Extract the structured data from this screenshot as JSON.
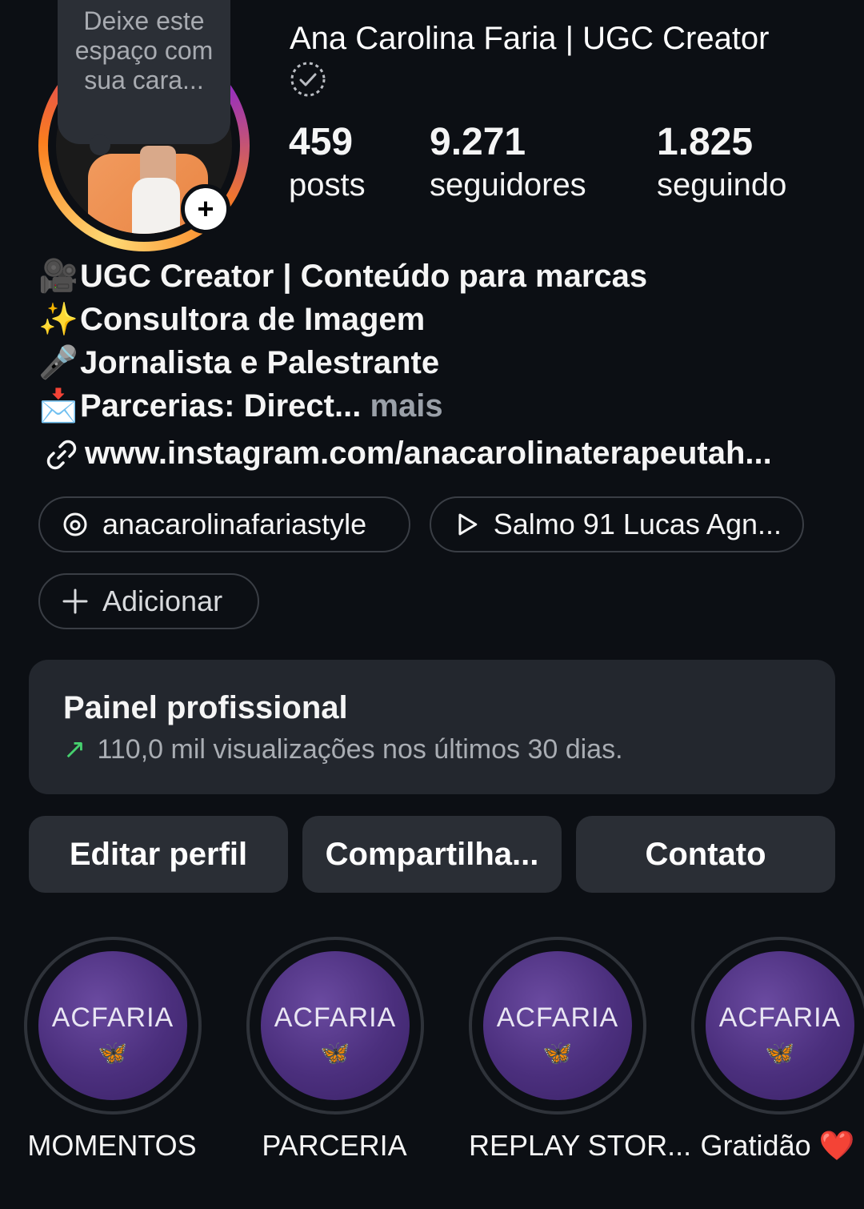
{
  "profile": {
    "name": "Ana Carolina Faria | UGC Creator",
    "note_placeholder": "Deixe este espaço com sua cara...",
    "stats": [
      {
        "value": "459",
        "label": "posts"
      },
      {
        "value": "9.271",
        "label": "seguidores"
      },
      {
        "value": "1.825",
        "label": "seguindo"
      }
    ],
    "bio": [
      {
        "emoji": "🎥",
        "text": "UGC Creator | Conteúdo para marcas"
      },
      {
        "emoji": "✨",
        "text": "Consultora de Imagem"
      },
      {
        "emoji": "🎤",
        "text": "Jornalista e Palestrante"
      },
      {
        "emoji": "📩",
        "text": "Parcerias: Direct..."
      }
    ],
    "more_label": "mais",
    "link": "www.instagram.com/anacarolinaterapeutah..."
  },
  "pills": {
    "threads": "anacarolinafariastyle",
    "music": "Salmo 91 Lucas Agn...",
    "add": "Adicionar"
  },
  "panel": {
    "title": "Painel profissional",
    "subtitle": "110,0 mil visualizações nos últimos 30 dias."
  },
  "buttons": {
    "edit": "Editar perfil",
    "share": "Compartilha...",
    "contact": "Contato"
  },
  "highlights": [
    {
      "brand": "ACFARIA",
      "label": "MOMENTOS"
    },
    {
      "brand": "ACFARIA",
      "label": "PARCERIA"
    },
    {
      "brand": "ACFARIA",
      "label": "REPLAY STOR..."
    },
    {
      "brand": "ACFARIA",
      "label": "Gratidão ❤️"
    }
  ],
  "colors": {
    "background": "#0c0f14",
    "surface": "#23272e",
    "button": "#2a2e35",
    "trend_green": "#46d06e"
  }
}
